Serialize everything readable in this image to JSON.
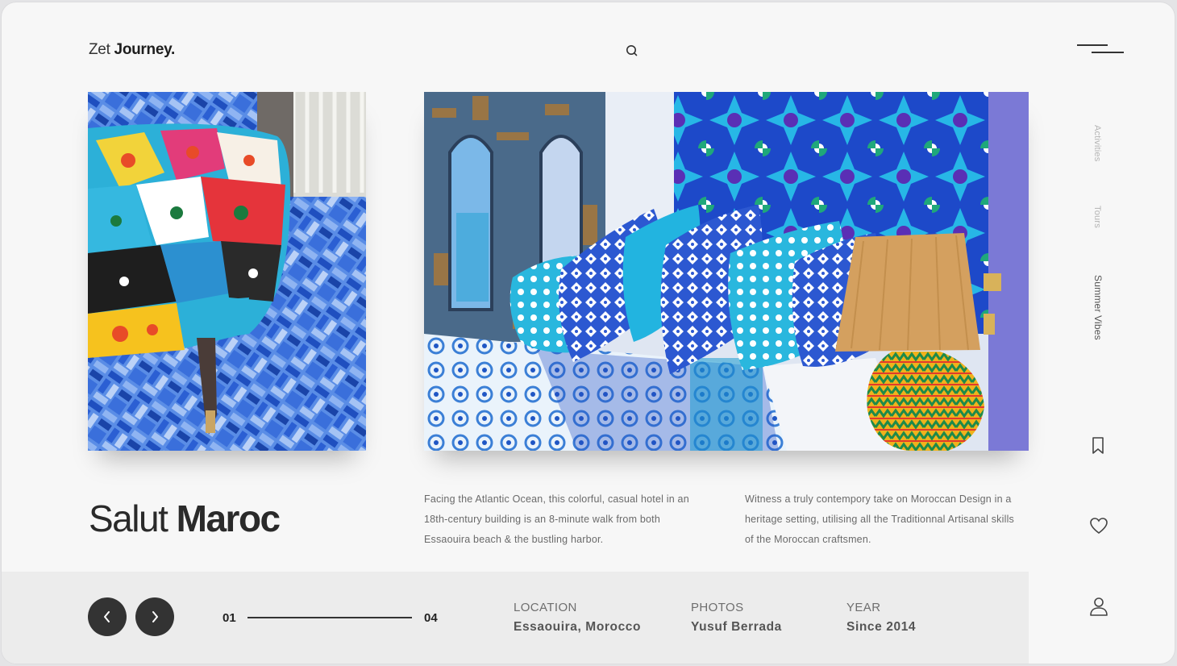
{
  "brand": {
    "name_light": "Zet",
    "name_bold": "Journey."
  },
  "header": {
    "search_icon": "search-icon",
    "menu_icon": "hamburger-menu-icon"
  },
  "side_nav": {
    "links": [
      "Activities",
      "Tours",
      "Summer Vibes"
    ],
    "active_index": 2,
    "icons": [
      "bookmark-icon",
      "heart-icon",
      "user-icon"
    ]
  },
  "hero": {
    "title_light": "Salut",
    "title_bold": "Maroc"
  },
  "descriptions": [
    "Facing the Atlantic Ocean, this colorful, casual hotel in an 18th-century building is an 8-minute walk from both Essaouira beach & the bustling harbor.",
    "Witness a truly contempory take on Moroccan Design in a heritage setting, utilising all the Traditionnal Artisanal skills of the Moroccan craftsmen."
  ],
  "slider": {
    "current": "01",
    "total": "04",
    "progress_fraction": 1.0
  },
  "meta": [
    {
      "label": "LOCATION",
      "value": "Essaouira, Morocco"
    },
    {
      "label": "PHOTOS",
      "value": "Yusuf Berrada"
    },
    {
      "label": "YEAR",
      "value": "Since 2014"
    }
  ],
  "colors": {
    "dark": "#333333",
    "background": "#f7f7f7",
    "bar": "#ececec",
    "accent_blue": "#2a62c9"
  }
}
